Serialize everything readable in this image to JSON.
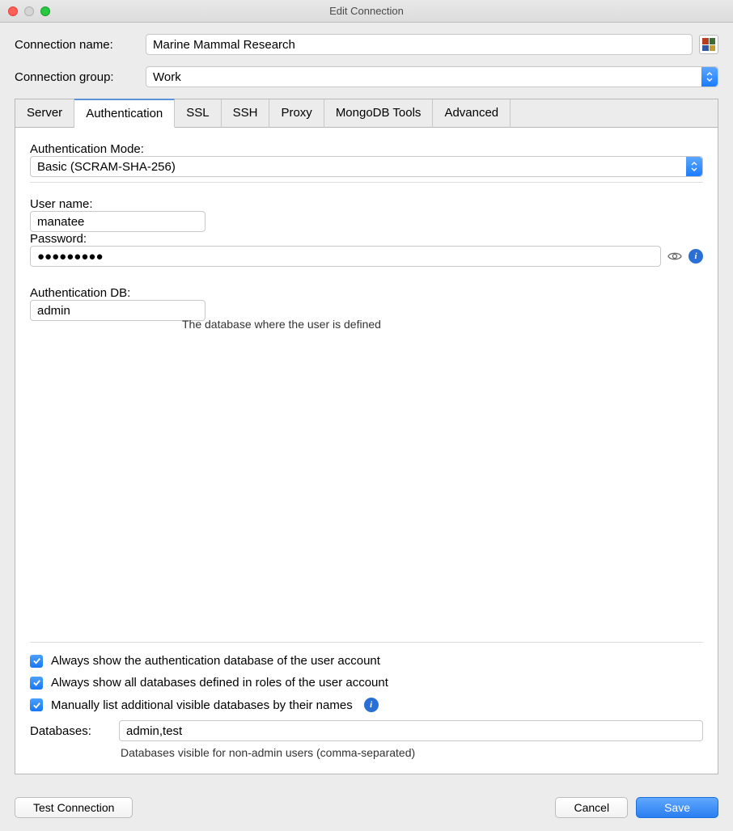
{
  "window": {
    "title": "Edit Connection"
  },
  "labels": {
    "connection_name": "Connection name:",
    "connection_group": "Connection group:"
  },
  "fields": {
    "connection_name": "Marine Mammal Research",
    "connection_group": "Work"
  },
  "color_grid": [
    "#b43f1e",
    "#3a6f2f",
    "#2f5aa0",
    "#c59a2f"
  ],
  "tabs": [
    "Server",
    "Authentication",
    "SSL",
    "SSH",
    "Proxy",
    "MongoDB Tools",
    "Advanced"
  ],
  "active_tab": 1,
  "auth": {
    "mode_label": "Authentication Mode:",
    "mode_value": "Basic (SCRAM-SHA-256)",
    "user_label": "User name:",
    "user_value": "manatee",
    "password_label": "Password:",
    "password_value": "●●●●●●●●●",
    "authdb_label": "Authentication DB:",
    "authdb_value": "admin",
    "authdb_helper": "The database where the user is defined"
  },
  "checks": {
    "c1": "Always show the authentication database of the user account",
    "c2": "Always show all databases defined in roles of the user account",
    "c3": "Manually list additional visible databases by their names"
  },
  "databases": {
    "label": "Databases:",
    "value": "admin,test",
    "helper": "Databases visible for non-admin users (comma-separated)"
  },
  "footer": {
    "test": "Test Connection",
    "cancel": "Cancel",
    "save": "Save"
  }
}
